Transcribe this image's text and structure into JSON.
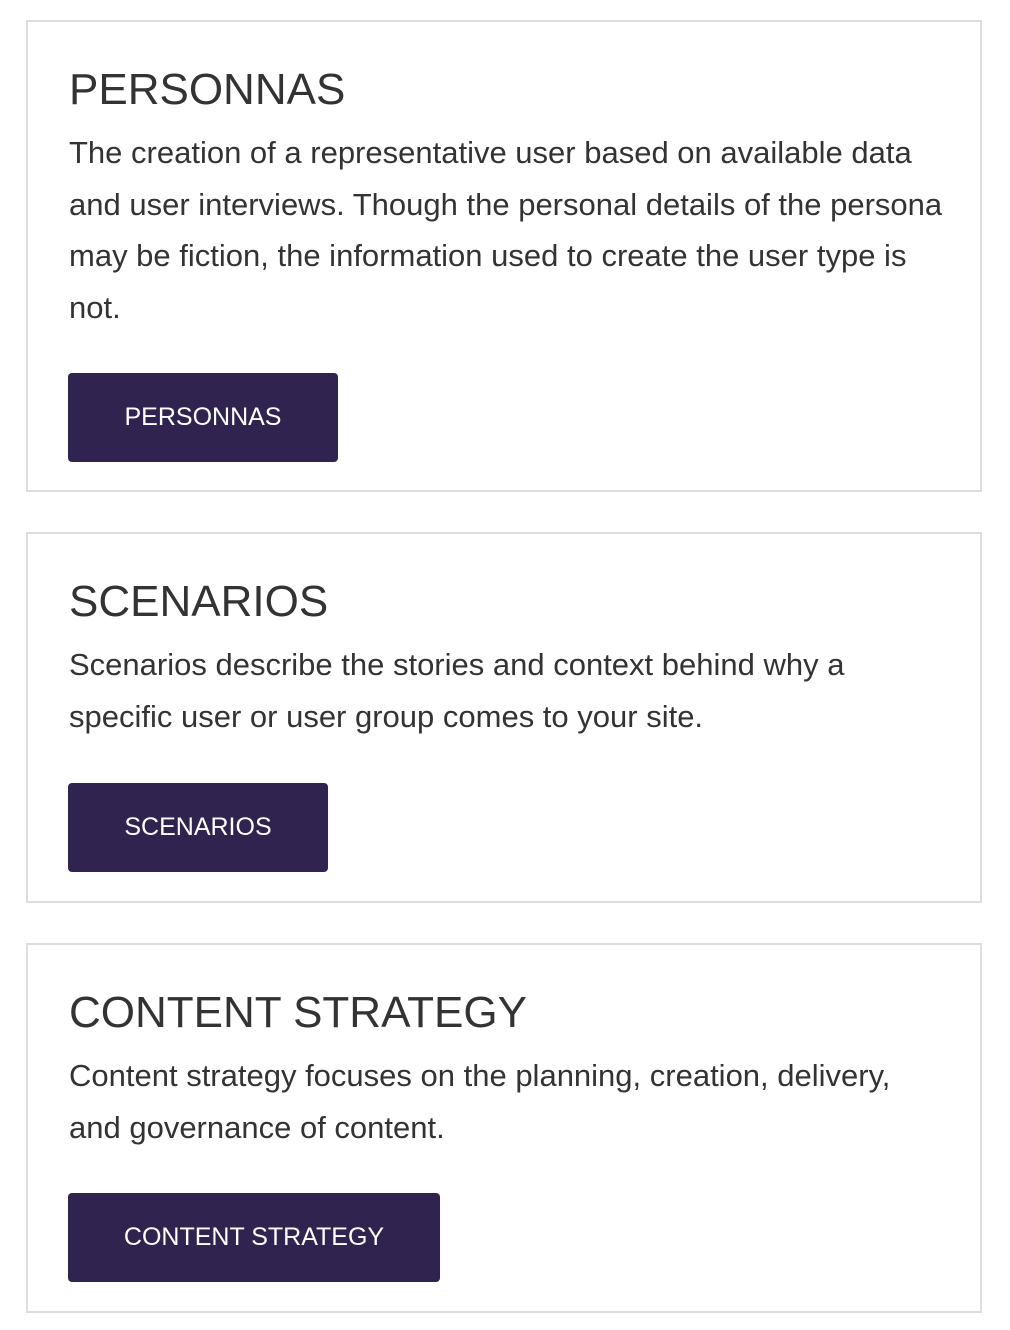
{
  "colors": {
    "button_background": "#30234f",
    "button_text": "#ffffff",
    "card_border": "#dedede",
    "text": "#333333"
  },
  "cards": [
    {
      "title": "PERSONNAS",
      "description": "The creation of a representative user based on available data and user interviews. Though the personal details of the persona may be fiction, the information used to create the user type is not.",
      "button_label": "PERSONNAS"
    },
    {
      "title": "SCENARIOS",
      "description": "Scenarios describe the stories and context behind why a specific user or user group comes to your site.",
      "button_label": "SCENARIOS"
    },
    {
      "title": "CONTENT STRATEGY",
      "description": "Content strategy focuses on the planning, creation, delivery, and governance of content.",
      "button_label": "CONTENT STRATEGY"
    }
  ]
}
